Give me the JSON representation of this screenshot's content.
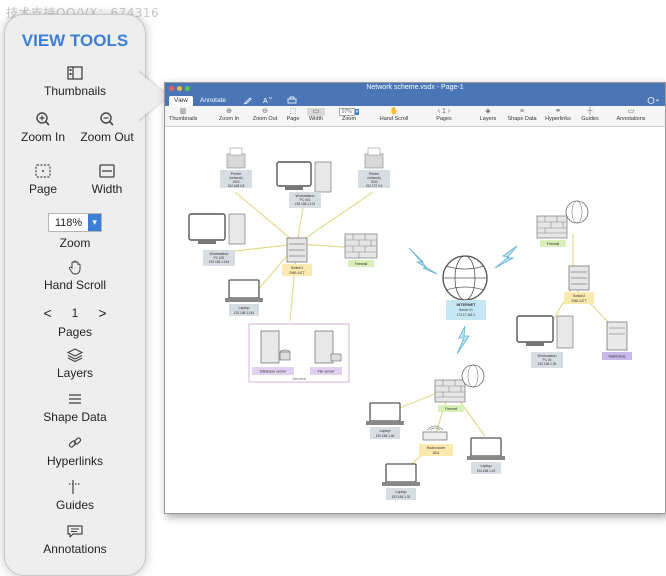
{
  "watermark": "技术支持QQ/VX：674316",
  "panel": {
    "title": "VIEW TOOLS",
    "thumbnails": "Thumbnails",
    "zoom_in": "Zoom In",
    "zoom_out": "Zoom Out",
    "page": "Page",
    "width": "Width",
    "zoom_value": "118%",
    "zoom": "Zoom",
    "hand_scroll": "Hand Scroll",
    "page_prev": "<",
    "page_num": "1",
    "page_next": ">",
    "pages": "Pages",
    "layers": "Layers",
    "shape_data": "Shape Data",
    "hyperlinks": "Hyperlinks",
    "guides": "Guides",
    "annotations": "Annotations"
  },
  "window": {
    "title": "Network scheme.vsdx - Page-1",
    "tab_view": "View",
    "tab_annotate": "Annotate",
    "ribbon": {
      "thumbnails": "Thumbnails",
      "zoom_in": "Zoom In",
      "zoom_out": "Zoom Out",
      "page": "Page",
      "width": "Width",
      "zoom_value": "97%",
      "zoom": "Zoom",
      "hand_scroll": "Hand Scroll",
      "page_num": "1",
      "pages": "Pages",
      "layers": "Layers",
      "shape_data": "Shape Data",
      "hyperlinks": "Hyperlinks",
      "guides": "Guides",
      "annotations": "Annotations"
    }
  },
  "diagram": {
    "printer1_name": "Printer",
    "printer1_sub": "(network)",
    "printer1_sub2": "1900",
    "printer1_ip": "192.168.0.8",
    "workstation1_name": "Workstation",
    "workstation1_sub": "PC #01",
    "workstation1_ip": "192.168.1.123",
    "printer2_name": "Printer",
    "printer2_sub": "(network)",
    "printer2_sub2": "7000",
    "printer2_ip": "192.172.0.4",
    "workstation2_name": "Workstation",
    "workstation2_sub": "PC #02",
    "workstation2_ip": "192.168.1.164",
    "switch1_name": "Switch1",
    "switch1_sub": "2960-24TT",
    "firewall1": "Firewall",
    "laptop1_name": "Laptop",
    "laptop1_ip": "192.168.1.164",
    "database_server": "Database server",
    "file_server": "File server",
    "servers_group": "Servers",
    "internet_name": "INTERNET",
    "internet_sub": "Server #1",
    "internet_ip": "172.17.161.2",
    "firewall2": "Firewall",
    "switch2_name": "Switch2",
    "switch2_sub": "2960-24TT",
    "workstation3_name": "Workstation",
    "workstation3_sub": "PC #3",
    "workstation3_ip": "192.168.1.35",
    "mainframe": "Mainframe",
    "firewall3": "Firewall",
    "laptop2_name": "Laptop",
    "laptop2_ip": "192.168.1.46",
    "radiorouter_name": "Radiorouter",
    "radiorouter_sub": "2811",
    "laptop3_name": "Laptop",
    "laptop3_ip": "192.168.1.43",
    "laptop4_name": "Laptop",
    "laptop4_ip": "192.168.1.32"
  }
}
